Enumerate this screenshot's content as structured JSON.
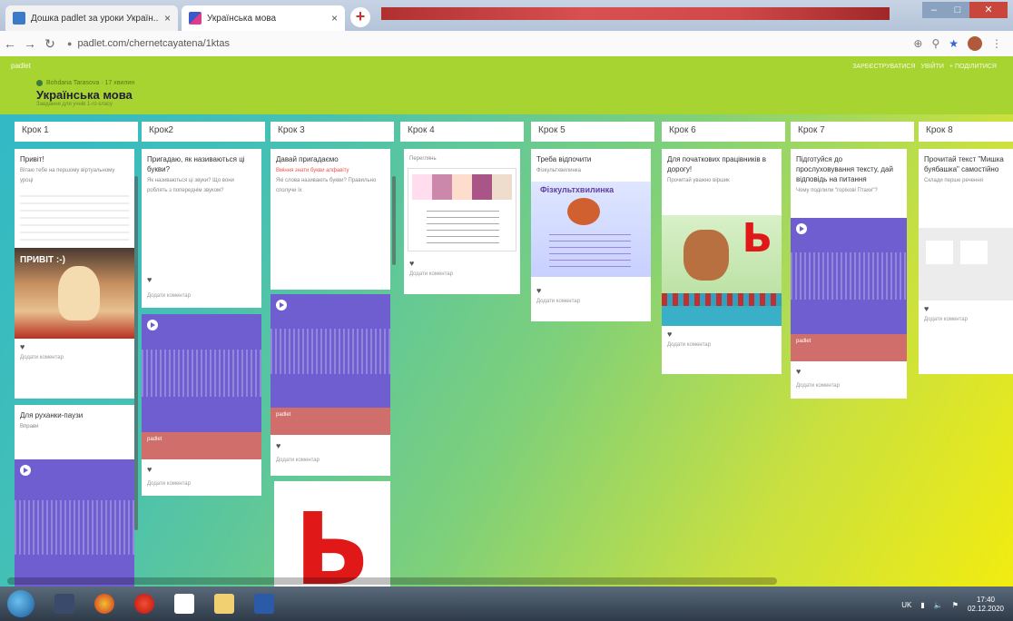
{
  "browser": {
    "tabs": [
      {
        "title": "Дошка padlet за уроки Україн...",
        "close": "×"
      },
      {
        "title": "Українська мова",
        "close": "×"
      }
    ],
    "new_tab": "+",
    "url": "padlet.com/chernetcayatena/1ktas"
  },
  "padlet": {
    "brand": "padlet",
    "author": "Bohdana Tarasova · 17 хвилин",
    "title": "Українська мова",
    "subtitle": "Завдання для учнів 1-го класу",
    "top_right": [
      "ЗАРЕЄСТРУВАТИСЯ",
      "УВІЙТИ",
      "+ ПОДІЛИТИСЯ"
    ],
    "columns": [
      {
        "title": "Крок 1"
      },
      {
        "title": "Крок2"
      },
      {
        "title": "Крок 3"
      },
      {
        "title": "Крок 4"
      },
      {
        "title": "Крок 5"
      },
      {
        "title": "Крок 6"
      },
      {
        "title": "Крок 7"
      },
      {
        "title": "Крок 8"
      }
    ],
    "cards": {
      "k1_title": "Привіт!",
      "k1_body": "Вітаю тебе на першому віртуальному уроці",
      "k1_img": "ПРИВІТ :-)",
      "k1_2_title": "Для руханки-паузи",
      "k1_2_body": "Вправи",
      "k2_title": "Пригадаю, як називаються ці букви?",
      "k2_body": "Як називаються ці звуки? Що вони роблять з попереднім звуком?",
      "k2_audio_label": "padlet",
      "k3_title": "Давай пригадаємо",
      "k3_body_red": "Вміння знати букви алфавіту",
      "k3_body": "Які слова називають букви? Правильно сполучи їх",
      "k3_audio_label": "padlet",
      "k3_letter": "Ь",
      "k4_title": "Переглянь",
      "k5_title": "Треба відпочити",
      "k5_body": "Фізкультхвилинка",
      "k5_poster": "Фізкультхвилинка",
      "k6_title": "Для початкових працівників в дорогу!",
      "k6_body": "Прочитай уважно віршик",
      "k6_letter": "Ь",
      "k7_title": "Підготуйся до прослуховування тексту, дай відповідь на питання",
      "k7_body": "Чому поділили \"горіхові Птахи\"?",
      "k7_audio_label": "padlet",
      "k8_title": "Прочитай текст \"Мишка буябашка\" самостійно",
      "k8_body": "Склади перше речення"
    },
    "comment_placeholder": "Додати коментар"
  },
  "taskbar": {
    "lang": "UK",
    "time": "17:40",
    "date": "02.12.2020"
  },
  "colors": {
    "audio": "#6f5ed0",
    "audio_label": "#cf6e6a",
    "accent_green": "#a8d432"
  }
}
